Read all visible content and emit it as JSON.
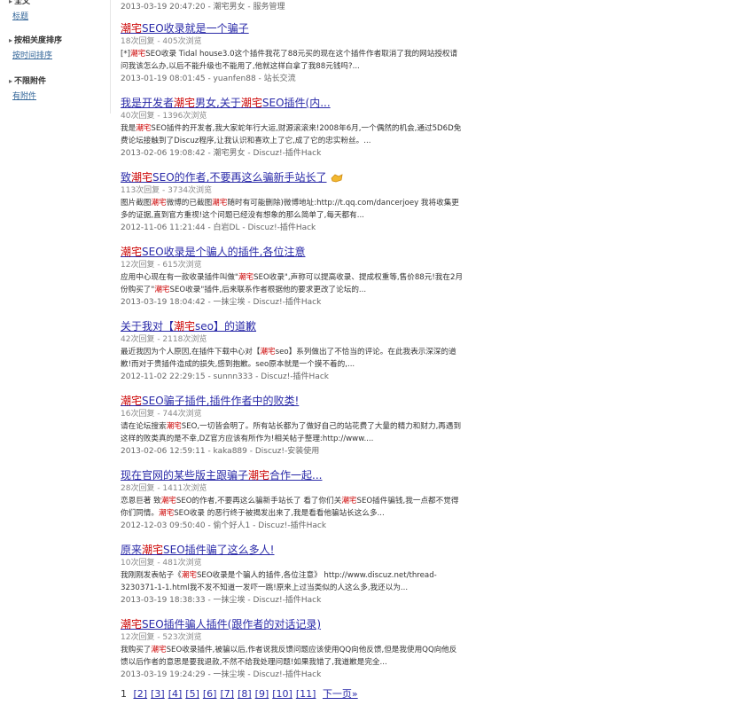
{
  "sidebar": {
    "group1": {
      "title": "全文",
      "link": "标题"
    },
    "group2": {
      "title": "按相关度排序",
      "link": "按时间排序"
    },
    "group3": {
      "title": "不限附件",
      "link": "有附件"
    }
  },
  "top_meta": "2013-03-19 20:47:20 - 潮宅男女 - 服务管理",
  "results": [
    {
      "title_parts": [
        "",
        "潮宅",
        "SEO收录就是一个骗子"
      ],
      "stats": "18次回复 - 405次浏览",
      "summary_parts": [
        "[*]",
        "潮宅",
        "SEO收录 Tidal house3.0这个插件我花了88元买的现在这个插件作者取消了我的网站授权请问我该怎么办,以后不能升级也不能用了,他就这样白拿了我88元钱吗?..."
      ],
      "meta": "2013-01-19 08:01:45 - yuanfen88 - 站长交流"
    },
    {
      "title_parts": [
        "我是开发者",
        "潮宅",
        "男女,关于",
        "潮宅",
        "SEO插件(内..."
      ],
      "stats": "40次回复 - 1396次浏览",
      "summary_parts": [
        "我是",
        "潮宅",
        "SEO插件的开发者,我大家蛇年行大运,财源滚滚来!2008年6月,一个偶然的机会,通过5D6D免费论坛接触到了Discuz程序,让我认识和喜欢上了它,成了它的忠实粉丝。..."
      ],
      "meta": "2013-02-06 19:08:42 - 潮宅男女 - Discuz!-插件Hack"
    },
    {
      "title_parts": [
        "致",
        "潮宅",
        "SEO的作者,不要再这么骗新手站长了"
      ],
      "stats": "113次回复 - 3734次浏览",
      "summary_parts": [
        "图片截图",
        "潮宅",
        "微博的已截图",
        "潮宅",
        "随时有可能删除)微博地址:http://t.qq.com/dancerjoey 我将收集更多的证据,直到官方重视!这个问题已经没有想象的那么简单了,每天都有..."
      ],
      "meta": "2012-11-06 11:21:44 - 白岩DL - Discuz!-插件Hack"
    },
    {
      "title_parts": [
        "",
        "潮宅",
        "SEO收录是个骗人的插件,各位注意"
      ],
      "stats": "12次回复 - 615次浏览",
      "summary_parts": [
        "应用中心现在有一款收录插件叫做\"",
        "潮宅",
        "SEO收录\",声称可以提高收录、提成权重等,售价88元!我在2月份购买了\"",
        "潮宅",
        "SEO收录\"插件,后来联系作者根据他的要求更改了论坛的..."
      ],
      "meta": "2013-03-19 18:04:42 - 一抹尘埃 - Discuz!-插件Hack"
    },
    {
      "title_parts": [
        "关于我对【",
        "潮宅",
        "seo】的道歉"
      ],
      "stats": "42次回复 - 2118次浏览",
      "summary_parts": [
        "最近我因为个人原因,在插件下载中心对【",
        "潮宅",
        "seo】系列做出了不恰当的评论。在此我表示深深的道歉!而对于贵插件造成的损失,感到抱歉。seo原本就是一个摸不着的,..."
      ],
      "meta": "2012-11-02 22:29:15 - sunnn333 - Discuz!-插件Hack"
    },
    {
      "title_parts": [
        "",
        "潮宅",
        "SEO骗子插件,插件作者中的败类!"
      ],
      "stats": "16次回复 - 744次浏览",
      "summary_parts": [
        "请在论坛搜索",
        "潮宅",
        "SEO,一切皆会明了。所有站长都为了做好自己的站花费了大量的精力和财力,再遇到这样的败类真的是不幸,DZ官方应该有所作为!相关帖子整理:http://www...."
      ],
      "meta": "2013-02-06 12:59:11 - kaka889 - Discuz!-安装使用"
    },
    {
      "title_parts": [
        "现在官网的某些版主跟骗子",
        "潮宅",
        "合作一起..."
      ],
      "stats": "28次回复 - 1411次浏览",
      "summary_parts": [
        "恋恩巨著 致",
        "潮宅",
        "SEO的作者,不要再这么骗新手站长了 看了你们关",
        "潮宅",
        "SEO插件骗钱,我一点都不觉得你们同情。",
        "潮宅",
        "SEO收录 的恶行终于被揭发出来了,我是看看他骗站长这么多..."
      ],
      "meta": "2012-12-03 09:50:40 - 偷个好人1 - Discuz!-插件Hack"
    },
    {
      "title_parts": [
        "原来",
        "潮宅",
        "SEO插件骗了这么多人!"
      ],
      "stats": "10次回复 - 481次浏览",
      "summary_parts": [
        "我刚刚发表帖子《",
        "潮宅",
        "SEO收录是个骗人的插件,各位注意》 http://www.discuz.net/thread-3230371-1-1.html我不发不知道一发吓一跳!原来上过当类似的人这么多,我还以为..."
      ],
      "meta": "2013-03-19 18:38:33 - 一抹尘埃 - Discuz!-插件Hack"
    },
    {
      "title_parts": [
        "",
        "潮宅",
        "SEO插件骗人插件(跟作者的对话记录)"
      ],
      "stats": "12次回复 - 523次浏览",
      "summary_parts": [
        "我购买了",
        "潮宅",
        "SEO收录插件,被骗以后,作者说我反馈问题应该使用QQ向他反馈,但是我使用QQ向他反馈以后作者的意思是要我退款,不然不给我处理问题!如果我错了,我道歉是完全..."
      ],
      "meta": "2013-03-19 19:24:29 - 一抹尘埃 - Discuz!-插件Hack"
    }
  ],
  "pager": {
    "current": "1",
    "pages": [
      "[2]",
      "[3]",
      "[4]",
      "[5]",
      "[6]",
      "[7]",
      "[8]",
      "[9]",
      "[10]",
      "[11]"
    ],
    "next": "下一页»"
  },
  "colors": {
    "link": "#2a2aa8",
    "highlight": "#cc0000",
    "meta": "#666666"
  },
  "icons": {
    "emoji": "thumbs-emoji-icon"
  }
}
